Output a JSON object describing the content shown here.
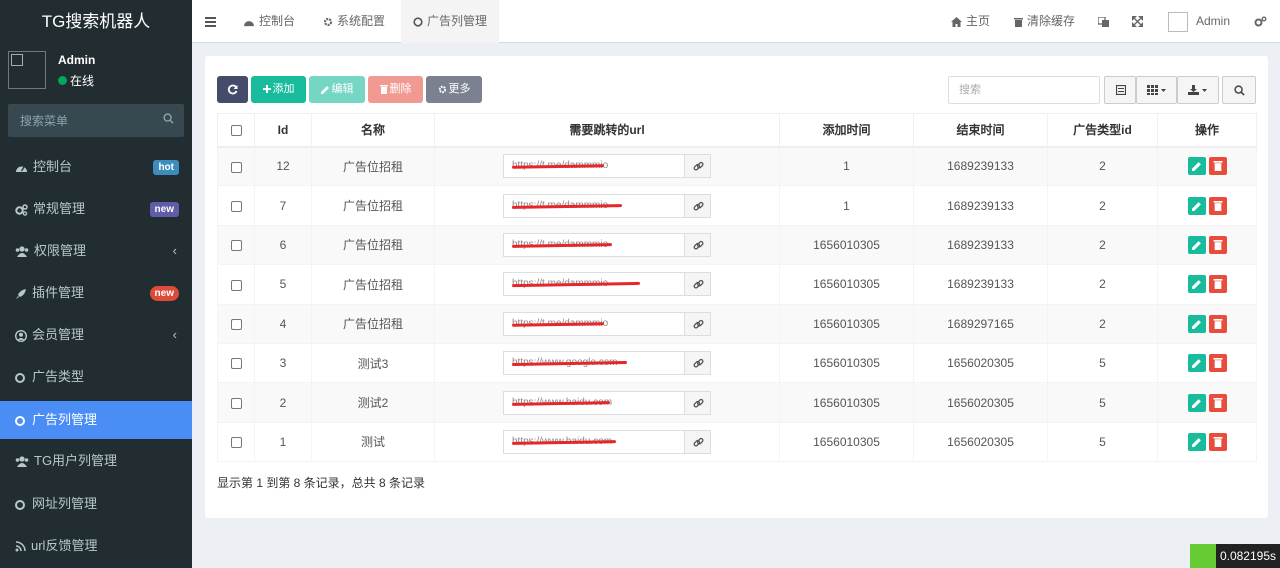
{
  "app_title": "TG搜索机器人",
  "user": {
    "name": "Admin",
    "status": "在线"
  },
  "sidebar_search_placeholder": "搜索菜单",
  "menu": [
    {
      "label": "控制台",
      "badge": "hot",
      "icon": "dashboard-icon"
    },
    {
      "label": "常规管理",
      "badge": "new",
      "icon": "cogs-icon"
    },
    {
      "label": "权限管理",
      "chevron": "‹",
      "icon": "users-icon"
    },
    {
      "label": "插件管理",
      "badge": "new",
      "icon": "rocket-icon"
    },
    {
      "label": "会员管理",
      "chevron": "‹",
      "icon": "user-circle-icon"
    },
    {
      "label": "广告类型",
      "icon": "circle-icon"
    },
    {
      "label": "广告列管理",
      "icon": "circle-icon",
      "active": true
    },
    {
      "label": "TG用户列管理",
      "icon": "users-icon"
    },
    {
      "label": "网址列管理",
      "icon": "circle-icon"
    },
    {
      "label": "url反馈管理",
      "icon": "rss-icon"
    }
  ],
  "topbar": {
    "tabs": [
      {
        "label": "控制台",
        "icon": "dashboard-icon"
      },
      {
        "label": "系统配置",
        "icon": "gear-icon"
      },
      {
        "label": "广告列管理",
        "icon": "circle-icon",
        "active": true
      }
    ],
    "home": "主页",
    "clear_cache": "清除缓存",
    "admin": "Admin"
  },
  "toolbar": {
    "add": "添加",
    "edit": "编辑",
    "delete": "删除",
    "more": "更多",
    "search_placeholder": "搜索"
  },
  "table": {
    "headers": [
      "Id",
      "名称",
      "需要跳转的url",
      "添加时间",
      "结束时间",
      "广告类型id",
      "操作"
    ],
    "rows": [
      {
        "id": "12",
        "name": "广告位招租",
        "url": "https://t.me/dammmio",
        "add_time": "1",
        "end_time": "1689239133",
        "type_id": "2"
      },
      {
        "id": "7",
        "name": "广告位招租",
        "url": "https://t.me/dammmio",
        "add_time": "1",
        "end_time": "1689239133",
        "type_id": "2"
      },
      {
        "id": "6",
        "name": "广告位招租",
        "url": "https://t.me/dammmio",
        "add_time": "1656010305",
        "end_time": "1689239133",
        "type_id": "2"
      },
      {
        "id": "5",
        "name": "广告位招租",
        "url": "https://t.me/dammmio",
        "add_time": "1656010305",
        "end_time": "1689239133",
        "type_id": "2"
      },
      {
        "id": "4",
        "name": "广告位招租",
        "url": "https://t.me/dammmio",
        "add_time": "1656010305",
        "end_time": "1689297165",
        "type_id": "2"
      },
      {
        "id": "3",
        "name": "测试3",
        "url": "https://www.google.com",
        "add_time": "1656010305",
        "end_time": "1656020305",
        "type_id": "5"
      },
      {
        "id": "2",
        "name": "测试2",
        "url": "https://www.baidu.com",
        "add_time": "1656010305",
        "end_time": "1656020305",
        "type_id": "5"
      },
      {
        "id": "1",
        "name": "测试",
        "url": "https://www.baidu.com",
        "add_time": "1656010305",
        "end_time": "1656020305",
        "type_id": "5"
      }
    ]
  },
  "footer_text": "显示第 1 到第 8 条记录，总共 8 条记录",
  "timer": "0.082195s",
  "colors": {
    "sidebar": "#222d32",
    "active": "#4a8df5",
    "add": "#18bc9c",
    "delete": "#e74c3c",
    "refresh": "#444c69"
  }
}
